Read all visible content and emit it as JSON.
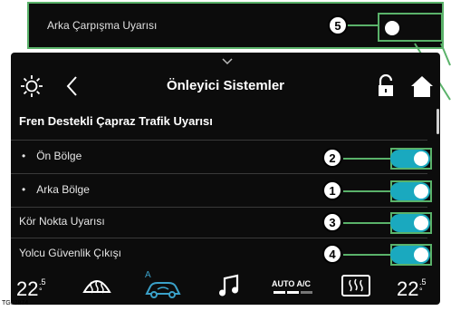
{
  "callout": {
    "label": "Arka Çarpışma Uyarısı",
    "badge": "5",
    "toggle_on": false
  },
  "screen": {
    "title": "Önleyici Sistemler",
    "section_header": "Fren Destekli Çapraz Trafik Uyarısı",
    "rows": [
      {
        "label": "Ön Bölge",
        "bullet": "•",
        "badge": "2",
        "toggle_on": true
      },
      {
        "label": "Arka Bölge",
        "bullet": "•",
        "badge": "1",
        "toggle_on": true
      },
      {
        "label": "Kör Nokta Uyarısı",
        "bullet": "",
        "badge": "3",
        "toggle_on": true
      },
      {
        "label": "Yolcu Güvenlik Çıkışı",
        "bullet": "",
        "badge": "4",
        "toggle_on": true
      }
    ],
    "icons": [
      "brightness-icon",
      "back-icon",
      "unlock-icon",
      "home-icon"
    ]
  },
  "bottom_bar": {
    "left_temp": "22",
    "left_temp_unit_top": ".5",
    "left_temp_unit_bottom": "°",
    "right_temp": "22",
    "right_temp_unit_top": ".5",
    "right_temp_unit_bottom": "°",
    "auto_ac": "AUTO A/C",
    "recirc_label": "A",
    "icons": [
      "front-defrost-icon",
      "recirculation-icon",
      "music-icon",
      "auto-ac-icon",
      "rear-defrost-icon"
    ]
  },
  "caption": "TG02874",
  "colors": {
    "accent_toggle": "#1aa9bf",
    "callout_frame": "#5ab26a",
    "screen_bg": "#0c0c0c",
    "recirc_icon": "#3aa0c8"
  }
}
